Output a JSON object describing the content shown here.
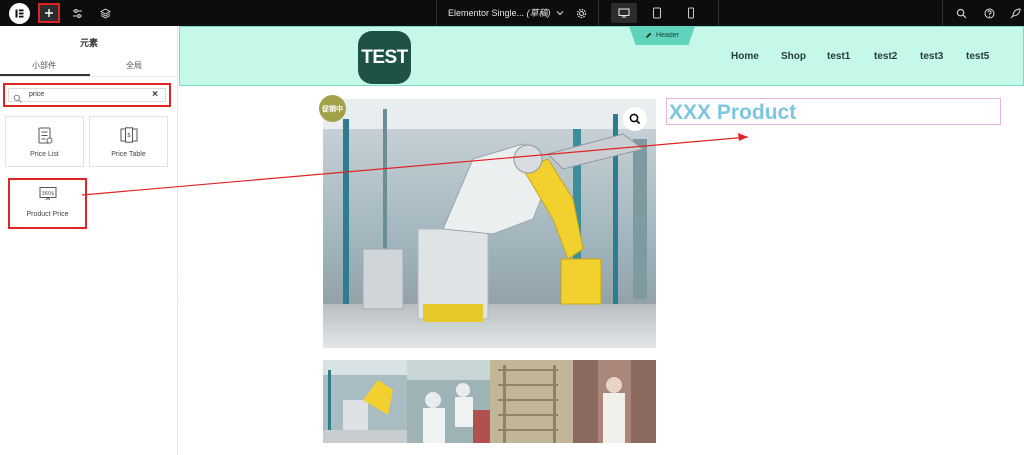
{
  "topbar": {
    "document_title": "Elementor Single...",
    "document_status": "(草稿)"
  },
  "panel": {
    "title": "元素",
    "tabs": [
      "小部件",
      "全局"
    ],
    "search": {
      "value": "price",
      "clear": "×"
    },
    "widgets": [
      {
        "label": "Price List",
        "icon": "price-list-icon"
      },
      {
        "label": "Price Table",
        "icon": "price-table-icon"
      },
      {
        "label": "Product Price",
        "icon": "product-price-icon"
      }
    ]
  },
  "canvas": {
    "header_tag": "Header",
    "logo_text": "TEST",
    "nav": [
      "Home",
      "Shop",
      "test1",
      "test2",
      "test3",
      "test5"
    ],
    "badge": "促销中",
    "product_title": "XXX Product"
  },
  "colors": {
    "accent_red": "#e02424",
    "header_bg": "#c6f8ea",
    "logo_bg": "#1e5245",
    "title_color": "#7ec6df"
  }
}
